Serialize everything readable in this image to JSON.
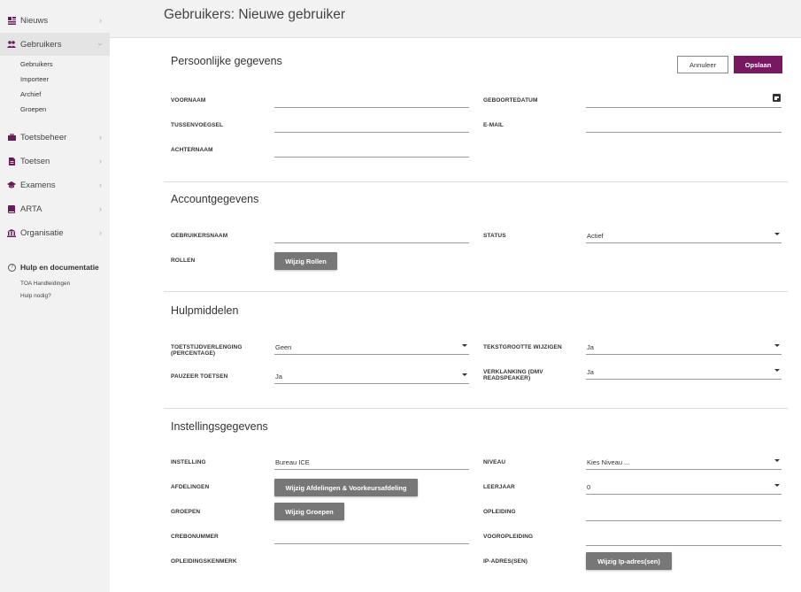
{
  "sidebar": {
    "nav": [
      {
        "label": "Nieuws",
        "icon": "news-icon"
      },
      {
        "label": "Gebruikers",
        "icon": "users-icon"
      },
      {
        "label": "Toetsbeheer",
        "icon": "briefcase-icon"
      },
      {
        "label": "Toetsen",
        "icon": "document-icon"
      },
      {
        "label": "Examens",
        "icon": "graduation-cap-icon"
      },
      {
        "label": "ARTA",
        "icon": "book-icon"
      },
      {
        "label": "Organisatie",
        "icon": "institution-icon"
      }
    ],
    "sub_items": [
      "Gebruikers",
      "Importeer",
      "Archief",
      "Groepen"
    ],
    "help": {
      "title": "Hulp en documentatie",
      "links": [
        "TOA Handleidingen",
        "Hulp nodig?"
      ]
    }
  },
  "header": {
    "title": "Gebruikers: Nieuwe gebruiker"
  },
  "actions": {
    "cancel": "Annuleer",
    "save": "Opslaan"
  },
  "personal": {
    "title": "Persoonlijke gegevens",
    "voornaam": {
      "label": "VOORNAAM",
      "value": ""
    },
    "tussenvoegsel": {
      "label": "TUSSENVOEGSEL",
      "value": ""
    },
    "achternaam": {
      "label": "ACHTERNAAM",
      "value": ""
    },
    "geboortedatum": {
      "label": "GEBOORTEDATUM",
      "value": ""
    },
    "email": {
      "label": "E-MAIL",
      "value": ""
    }
  },
  "account": {
    "title": "Accountgegevens",
    "gebruikersnaam": {
      "label": "GEBRUIKERSNAAM",
      "value": ""
    },
    "rollen": {
      "label": "ROLLEN",
      "button": "Wijzig Rollen"
    },
    "status": {
      "label": "STATUS",
      "value": "Actief"
    }
  },
  "aids": {
    "title": "Hulpmiddelen",
    "toetstijd": {
      "label_line1": "TOETSTIJDVERLENGING",
      "label_line2": "(PERCENTAGE)",
      "value": "Geen"
    },
    "pauzeer": {
      "label": "PAUZEER TOETSEN",
      "value": "Ja"
    },
    "tekstgrootte": {
      "label": "TEKSTGROOTTE WIJZIGEN",
      "value": "Ja"
    },
    "verklanking": {
      "label_line1": "VERKLANKING (DMV",
      "label_line2": "READSPEAKER)",
      "value": "Ja"
    }
  },
  "institution": {
    "title": "Instellingsgegevens",
    "instelling": {
      "label": "INSTELLING",
      "value": "Bureau ICE"
    },
    "afdelingen": {
      "label": "AFDELINGEN",
      "button": "Wijzig Afdelingen & Voorkeursafdeling"
    },
    "groepen": {
      "label": "GROEPEN",
      "button": "Wijzig Groepen"
    },
    "crebonummer": {
      "label": "CREBONUMMER",
      "value": ""
    },
    "opleidingskenmerk": {
      "label": "OPLEIDINGSKENMERK"
    },
    "niveau": {
      "label": "NIVEAU",
      "value": "Kies Niveau ..."
    },
    "leerjaar": {
      "label": "LEERJAAR",
      "value": "0"
    },
    "opleiding": {
      "label": "OPLEIDING",
      "value": ""
    },
    "vooropleiding": {
      "label": "VOOROPLEIDING",
      "value": ""
    },
    "ipadres": {
      "label": "IP-ADRES(SEN)",
      "button": "Wijzig Ip-adres(sen)"
    }
  },
  "colors": {
    "accent": "#7a1763",
    "sidebar_bg": "#f2f2f2",
    "button_grey": "#777777"
  }
}
